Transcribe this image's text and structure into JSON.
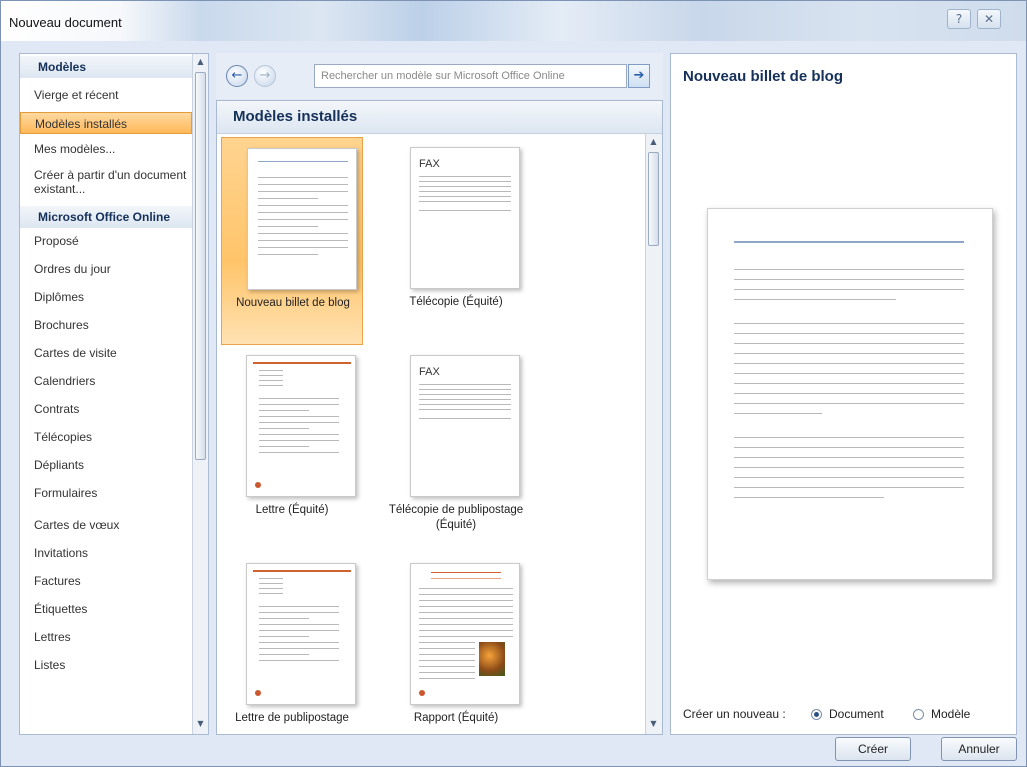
{
  "window": {
    "title": "Nouveau document",
    "help_glyph": "?",
    "close_glyph": "✕"
  },
  "sidebar": {
    "items": [
      {
        "label": "Modèles",
        "type": "header"
      },
      {
        "label": "Vierge et récent"
      },
      {
        "label": "Modèles installés",
        "selected": true
      },
      {
        "label": "Mes modèles..."
      },
      {
        "label": "Créer à partir d'un document existant..."
      },
      {
        "label": "Microsoft Office Online",
        "type": "header"
      },
      {
        "label": "Proposé"
      },
      {
        "label": "Ordres du jour"
      },
      {
        "label": "Diplômes"
      },
      {
        "label": "Brochures"
      },
      {
        "label": "Cartes de visite"
      },
      {
        "label": "Calendriers"
      },
      {
        "label": "Contrats"
      },
      {
        "label": "Télécopies"
      },
      {
        "label": "Dépliants"
      },
      {
        "label": "Formulaires"
      },
      {
        "label": "Cartes de vœux"
      },
      {
        "label": "Invitations"
      },
      {
        "label": "Factures"
      },
      {
        "label": "Étiquettes"
      },
      {
        "label": "Lettres"
      },
      {
        "label": "Listes"
      }
    ]
  },
  "toolbar": {
    "back_glyph": "←",
    "forward_glyph": "→",
    "search_placeholder": "Rechercher un modèle sur Microsoft Office Online",
    "go_glyph": "➔"
  },
  "templates": {
    "heading": "Modèles installés",
    "items": [
      {
        "label": "Nouveau billet de blog",
        "selected": true,
        "kind": "blog"
      },
      {
        "label": "Télécopie (Équité)",
        "kind": "fax",
        "fax_text": "FAX"
      },
      {
        "label": "Lettre (Équité)",
        "kind": "letter"
      },
      {
        "label": "Télécopie de publipostage (Équité)",
        "kind": "fax",
        "fax_text": "FAX"
      },
      {
        "label": "Lettre de publipostage",
        "kind": "letter"
      },
      {
        "label": "Rapport (Équité)",
        "kind": "report"
      }
    ]
  },
  "preview": {
    "title": "Nouveau billet de blog",
    "create_label": "Créer un nouveau :",
    "options": [
      {
        "label": "Document",
        "checked": true
      },
      {
        "label": "Modèle",
        "checked": false
      }
    ]
  },
  "buttons": {
    "create": "Créer",
    "cancel": "Annuler"
  },
  "scroll_glyphs": {
    "up": "▲",
    "down": "▼"
  }
}
